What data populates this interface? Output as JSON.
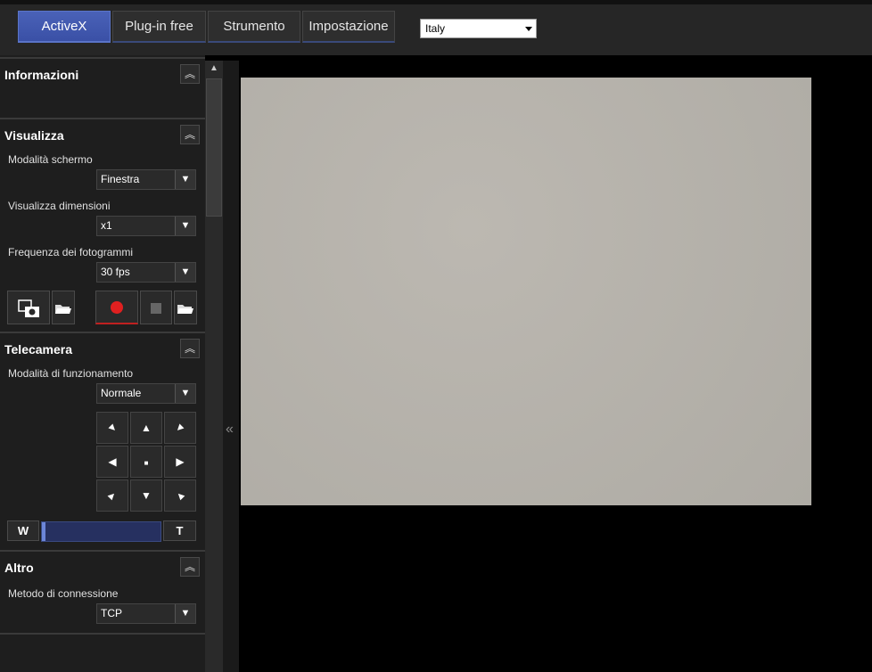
{
  "tabs": [
    {
      "label": "ActiveX",
      "active": true
    },
    {
      "label": "Plug-in free",
      "active": false
    },
    {
      "label": "Strumento",
      "active": false
    },
    {
      "label": "Impostazione",
      "active": false
    }
  ],
  "country": {
    "selected": "Italy"
  },
  "panel": {
    "informazioni": {
      "title": "Informazioni"
    },
    "visualizza": {
      "title": "Visualizza",
      "modalita_label": "Modalità schermo",
      "modalita_value": "Finestra",
      "dimensioni_label": "Visualizza dimensioni",
      "dimensioni_value": "x1",
      "frequenza_label": "Frequenza dei fotogrammi",
      "frequenza_value": "30 fps"
    },
    "telecamera": {
      "title": "Telecamera",
      "modalita_label": "Modalità di funzionamento",
      "modalita_value": "Normale",
      "zoom_wide": "W",
      "zoom_tele": "T",
      "zoom_level": 0.0
    },
    "altro": {
      "title": "Altro",
      "metodo_label": "Metodo di connessione",
      "metodo_value": "TCP"
    }
  },
  "colors": {
    "accent": "#4a62b8",
    "record": "#e02020"
  }
}
